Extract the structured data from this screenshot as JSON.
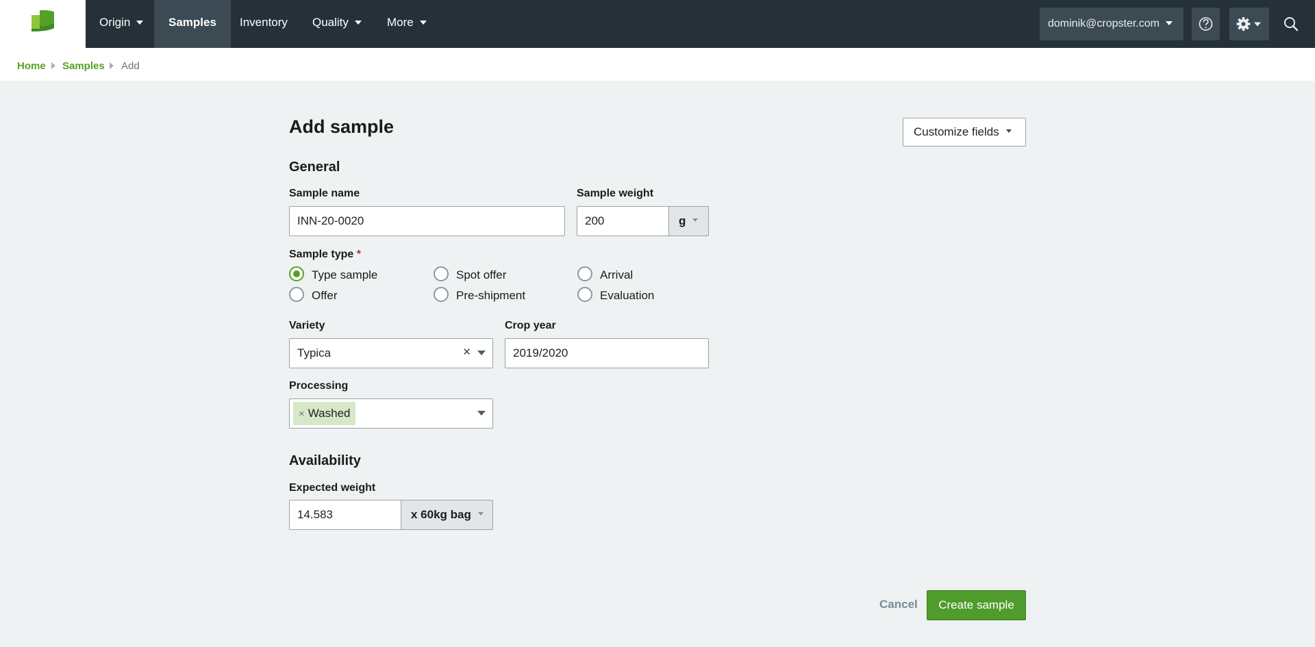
{
  "nav": {
    "items": [
      {
        "label": "Origin",
        "dropdown": true
      },
      {
        "label": "Samples",
        "active": true
      },
      {
        "label": "Inventory"
      },
      {
        "label": "Quality",
        "dropdown": true
      },
      {
        "label": "More",
        "dropdown": true
      }
    ],
    "user_email": "dominik@cropster.com",
    "help_icon": "help-circle-icon",
    "settings_icon": "gear-icon",
    "search_icon": "search-icon",
    "logo_icon": "cropster-leaf-logo"
  },
  "breadcrumb": [
    {
      "label": "Home"
    },
    {
      "label": "Samples"
    },
    {
      "label": "Add"
    }
  ],
  "form": {
    "title": "Add sample",
    "customize_label": "Customize fields",
    "general_title": "General",
    "sample_name_label": "Sample name",
    "sample_name_value": "INN-20-0020",
    "sample_weight_label": "Sample weight",
    "sample_weight_value": "200",
    "sample_weight_unit": "g",
    "sample_type_label": "Sample type",
    "required_mark": "*",
    "sample_types": [
      {
        "label": "Type sample",
        "checked": true
      },
      {
        "label": "Spot offer",
        "checked": false
      },
      {
        "label": "Arrival",
        "checked": false
      },
      {
        "label": "Offer",
        "checked": false
      },
      {
        "label": "Pre-shipment",
        "checked": false
      },
      {
        "label": "Evaluation",
        "checked": false
      }
    ],
    "variety_label": "Variety",
    "variety_value": "Typica",
    "clear_symbol": "×",
    "crop_year_label": "Crop year",
    "crop_year_value": "2019/2020",
    "processing_label": "Processing",
    "processing_tags": [
      "Washed"
    ],
    "availability_title": "Availability",
    "expected_weight_label": "Expected weight",
    "expected_weight_value": "14.583",
    "expected_weight_unit": "x 60kg bag",
    "cancel_label": "Cancel",
    "submit_label": "Create sample"
  },
  "colors": {
    "accent": "#55a127",
    "nav_bg": "#253038",
    "nav_active": "#3c4a53",
    "page_bg": "#eef2f2"
  }
}
